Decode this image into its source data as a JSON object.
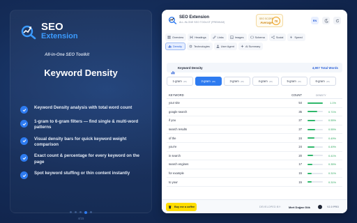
{
  "promo": {
    "brand_name": "SEO",
    "brand_ext": "Extension",
    "brand_tagline": "All-in-One SEO Toolkit",
    "title": "Keyword Density",
    "features": [
      "Keyword Density analysis with total word count",
      "1-gram to 6-gram filters — find single & multi-word patterns",
      "Visual density bars for quick keyword weight comparison",
      "Exact count & percentage for every keyword on the page",
      "Spot keyword stuffing or thin content instantly"
    ],
    "slide_counter": "4/15"
  },
  "panel": {
    "title": "SEO Extension",
    "subtitle": "ALL-IN-ONE SEO TOOLKIT (PREMIUM)",
    "score": {
      "label": "SEO SCORE",
      "status": "Average",
      "value": "70"
    },
    "lang_button": "EN",
    "tabs_row1": [
      {
        "label": "Overview",
        "icon": "grid-icon"
      },
      {
        "label": "Headings",
        "icon": "heading-icon"
      },
      {
        "label": "Links",
        "icon": "link-icon"
      },
      {
        "label": "Images",
        "icon": "image-icon"
      },
      {
        "label": "Schema",
        "icon": "schema-icon"
      },
      {
        "label": "Social",
        "icon": "share-icon"
      },
      {
        "label": "Speed",
        "icon": "speed-icon"
      }
    ],
    "tabs_row2": [
      {
        "label": "Density",
        "icon": "density-icon",
        "active": true
      },
      {
        "label": "Technologies",
        "icon": "chip-icon"
      },
      {
        "label": "User Agent",
        "icon": "user-icon"
      },
      {
        "label": "AI Summary",
        "icon": "sparkle-icon"
      }
    ],
    "keyword_section": {
      "title": "Keyword Density",
      "total": "4,907 Total Words"
    },
    "grams": [
      {
        "label": "1-gram",
        "count": "(30)"
      },
      {
        "label": "2-gram",
        "count": "(30)",
        "active": true
      },
      {
        "label": "3-gram",
        "count": "(30)"
      },
      {
        "label": "4-gram",
        "count": "(30)"
      },
      {
        "label": "5-gram",
        "count": "(30)"
      },
      {
        "label": "6-gram",
        "count": "(30)"
      }
    ],
    "table": {
      "headers": {
        "keyword": "KEYWORD",
        "count": "COUNT",
        "density": "DENSITY"
      },
      "rows": [
        {
          "keyword": "your site",
          "count": "54",
          "density": "1.1%",
          "fill": 1.0
        },
        {
          "keyword": "google search",
          "count": "35",
          "density": "0.71%",
          "fill": 0.65
        },
        {
          "keyword": "if you",
          "count": "27",
          "density": "0.55%",
          "fill": 0.5
        },
        {
          "keyword": "search results",
          "count": "27",
          "density": "0.55%",
          "fill": 0.5
        },
        {
          "keyword": "of the",
          "count": "24",
          "density": "0.49%",
          "fill": 0.45
        },
        {
          "keyword": "you're",
          "count": "24",
          "density": "0.49%",
          "fill": 0.45
        },
        {
          "keyword": "in search",
          "count": "20",
          "density": "0.41%",
          "fill": 0.37
        },
        {
          "keyword": "search engines",
          "count": "17",
          "density": "0.35%",
          "fill": 0.32
        },
        {
          "keyword": "for example",
          "count": "15",
          "density": "0.31%",
          "fill": 0.28
        },
        {
          "keyword": "to your",
          "count": "15",
          "density": "0.31%",
          "fill": 0.28
        }
      ]
    },
    "footer": {
      "coffee_label": "Buy me a coffee",
      "developed_by": "DEVELOPED BY:",
      "developer": "Mert Doğan Gök",
      "version": "V2.0 PRO"
    }
  },
  "colors": {
    "accent": "#2e7bf0",
    "density_bar": "#2fb86b",
    "score": "#f0a21e",
    "coffee": "#ffdd00"
  }
}
